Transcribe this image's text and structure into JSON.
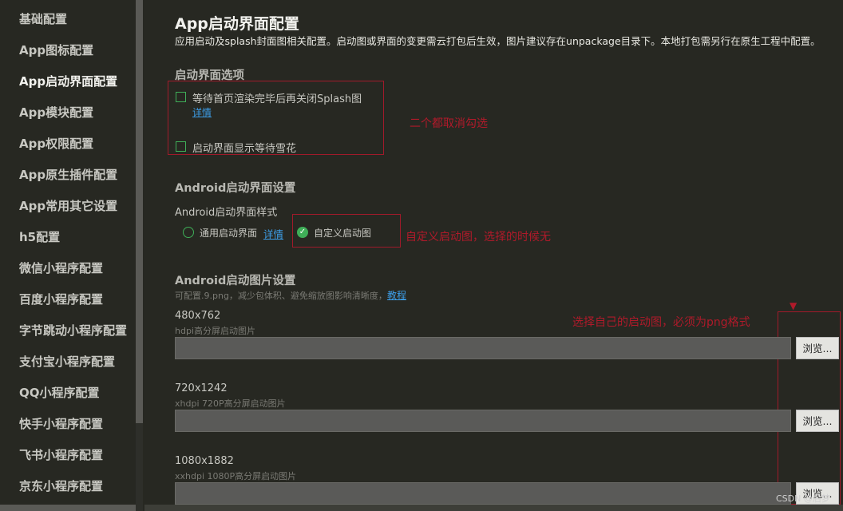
{
  "sidebar": {
    "items": [
      "基础配置",
      "App图标配置",
      "App启动界面配置",
      "App模块配置",
      "App权限配置",
      "App原生插件配置",
      "App常用其它设置",
      "h5配置",
      "微信小程序配置",
      "百度小程序配置",
      "字节跳动小程序配置",
      "支付宝小程序配置",
      "QQ小程序配置",
      "快手小程序配置",
      "飞书小程序配置",
      "京东小程序配置"
    ],
    "active_index": 2
  },
  "header": {
    "title": "App启动界面配置",
    "subtitle": "应用启动及splash封面图相关配置。启动图或界面的变更需云打包后生效，图片建议存在unpackage目录下。本地打包需另行在原生工程中配置。"
  },
  "splash_options": {
    "section_title": "启动界面选项",
    "opt1_label": "等待首页渲染完毕后再关闭Splash图",
    "opt1_detail": "详情",
    "opt2_label": "启动界面显示等待雪花",
    "annotation": "二个都取消勾选"
  },
  "android_settings": {
    "section_title": "Android启动界面设置",
    "style_label": "Android启动界面样式",
    "radio1_label": "通用启动界面",
    "radio1_detail": "详情",
    "radio2_label": "自定义启动图",
    "annotation": "自定义启动图，选择的时候无"
  },
  "android_images": {
    "section_title": "Android启动图片设置",
    "hint": "可配置.9.png，减少包体积、避免缩放图影响清晰度，",
    "hint_link": "教程",
    "annotation": "选择自己的启动图，必须为png格式",
    "browse_label": "浏览...",
    "images": [
      {
        "size": "480x762",
        "desc": "hdpi高分屏启动图片"
      },
      {
        "size": "720x1242",
        "desc": "xhdpi 720P高分屏启动图片"
      },
      {
        "size": "1080x1882",
        "desc": "xxhdpi 1080P高分屏启动图片"
      }
    ]
  },
  "watermark": "CSDN @后梦",
  "colors": {
    "background": "#272822",
    "accent": "#3fae58",
    "link": "#3d9ee8",
    "annotation": "#b01a2a"
  }
}
